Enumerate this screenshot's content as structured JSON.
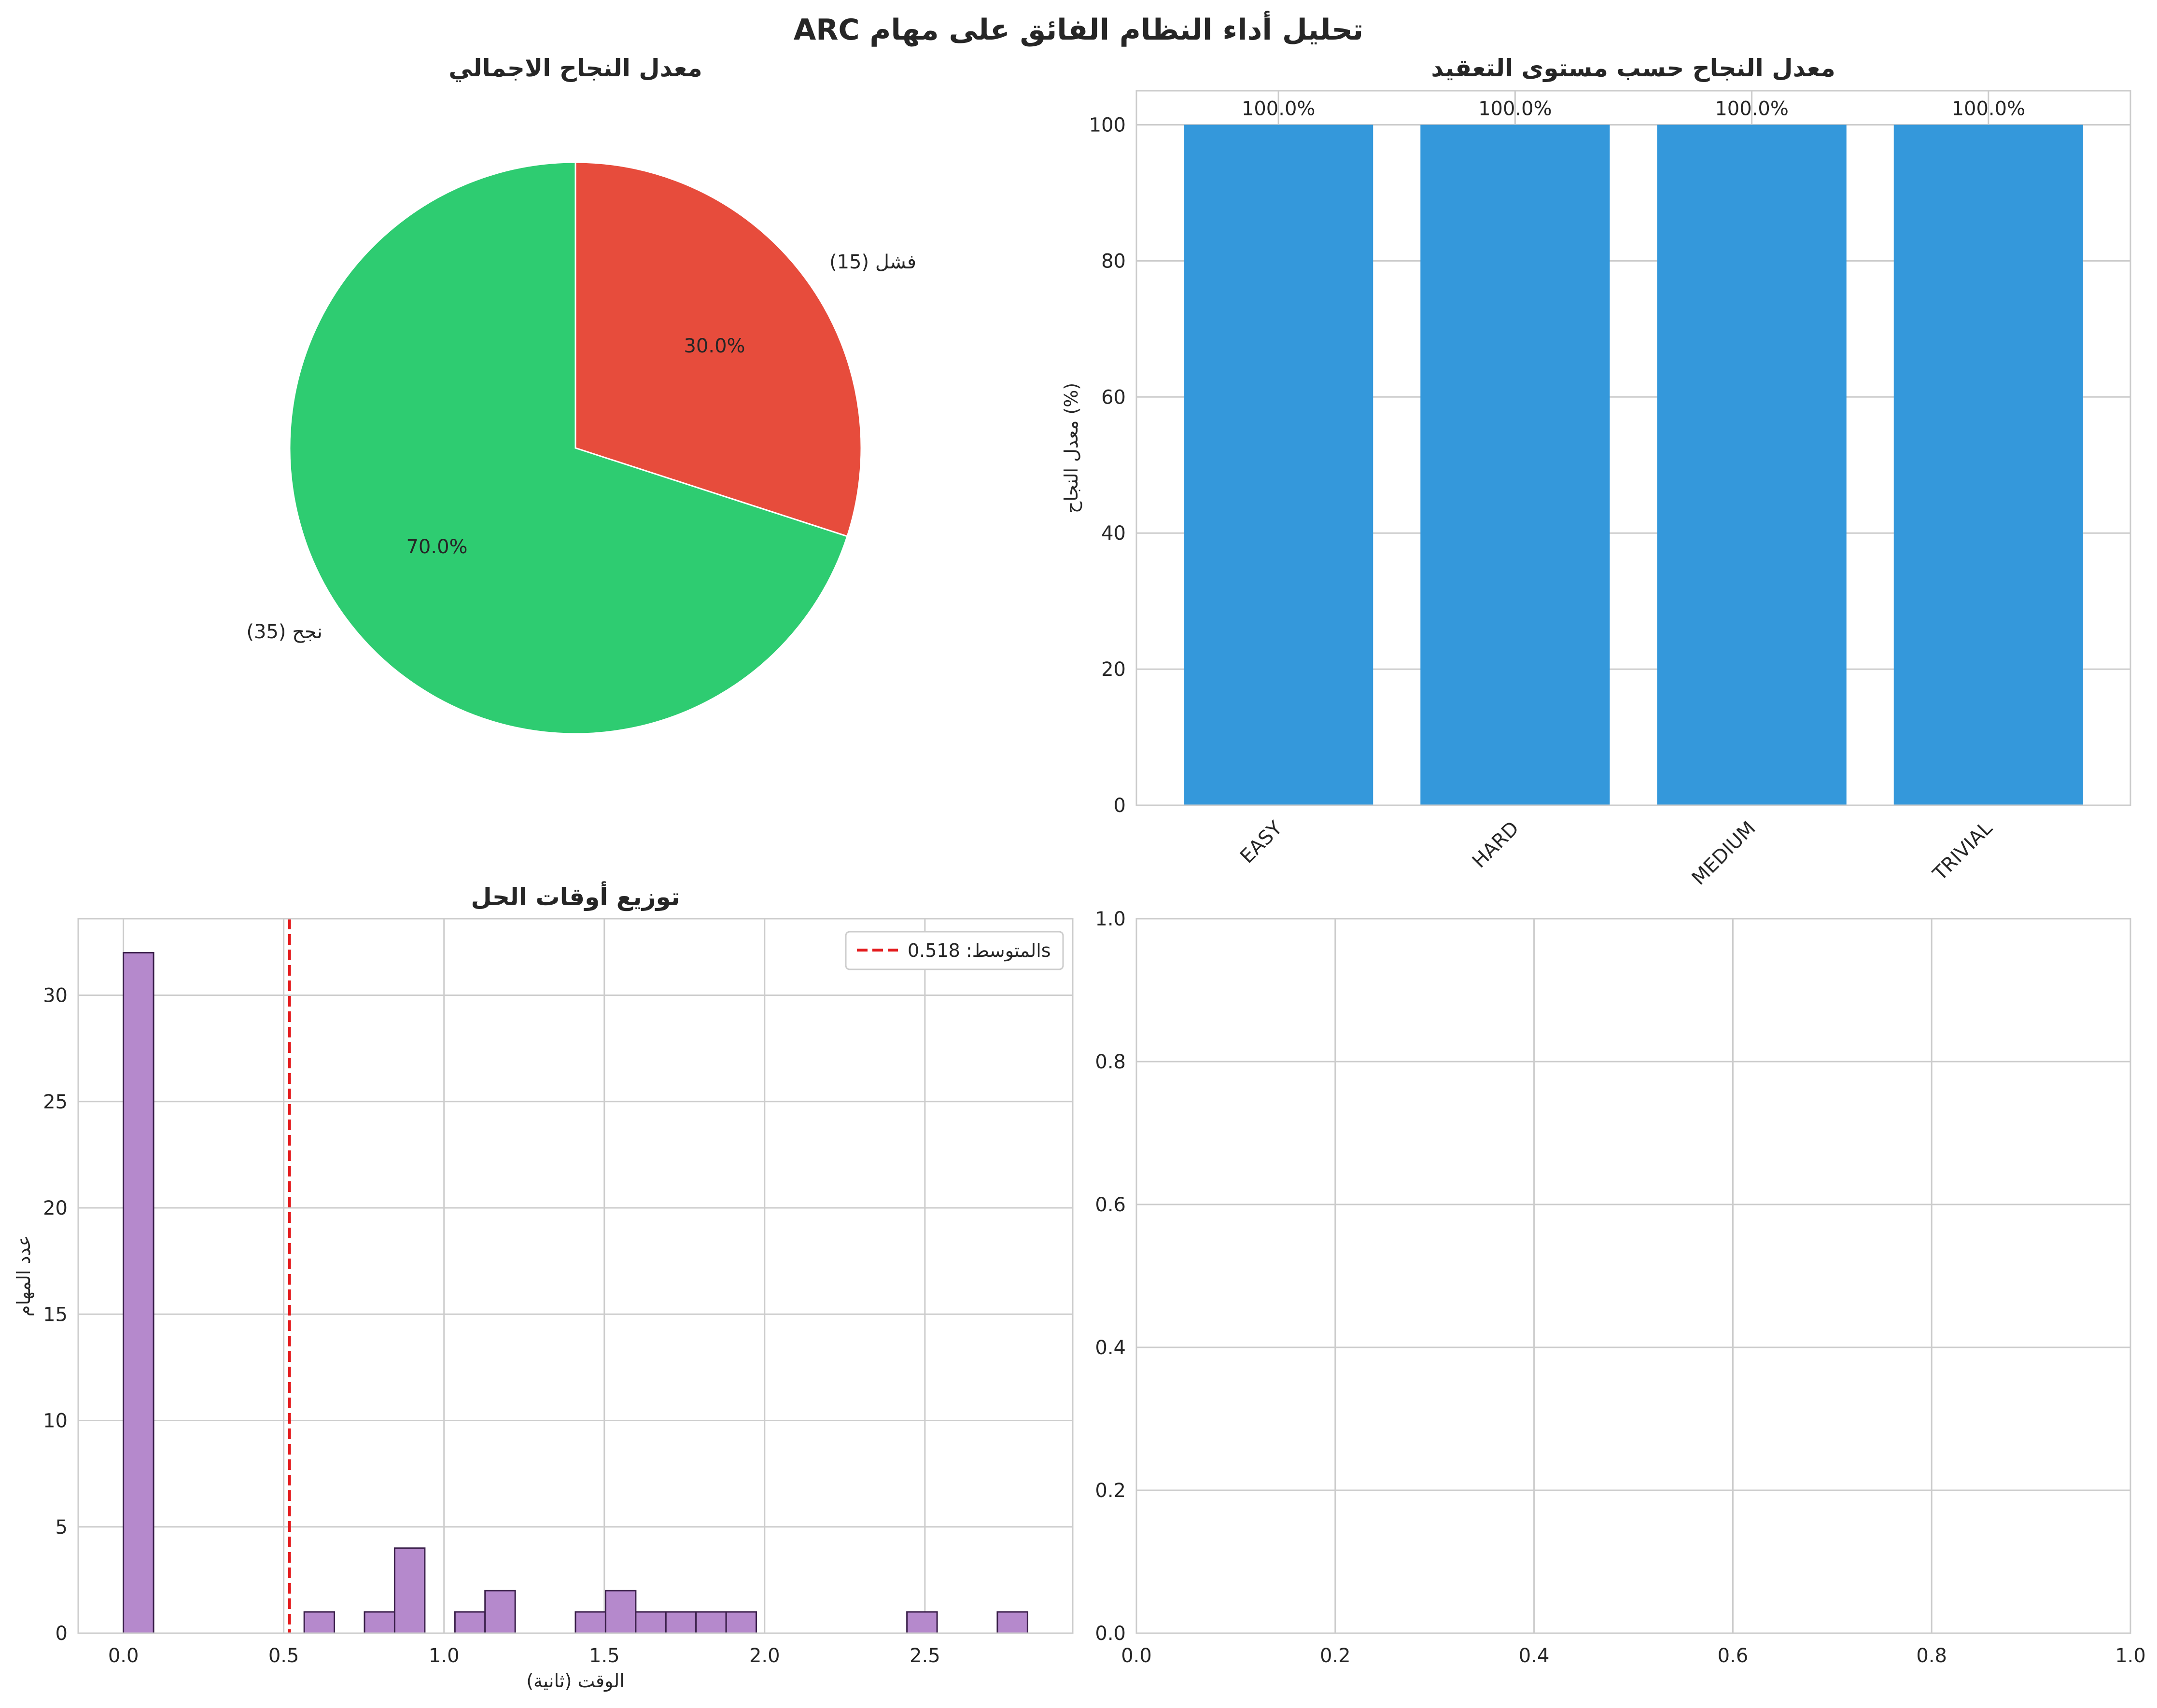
{
  "figure_title": "تحليل أداء النظام الفائق على مهام ARC",
  "colors": {
    "success": "#2ecc71",
    "failure": "#e74c3c",
    "bar": "#3498db",
    "hist": "#b589cc",
    "mean_line": "#e31a1c",
    "grid": "#cccccc"
  },
  "chart_data": [
    {
      "type": "pie",
      "title": "معدل النجاح الاجمالي",
      "slices": [
        {
          "label": "نجح (35)",
          "value": 35,
          "percent_label": "70.0%",
          "color": "#2ecc71"
        },
        {
          "label": "فشل (15)",
          "value": 15,
          "percent_label": "30.0%",
          "color": "#e74c3c"
        }
      ],
      "start_angle_deg": 90,
      "direction": "counterclockwise_from_failure"
    },
    {
      "type": "bar",
      "title": "معدل النجاح حسب مستوى التعقيد",
      "categories": [
        "EASY",
        "HARD",
        "MEDIUM",
        "TRIVIAL"
      ],
      "values": [
        100,
        100,
        100,
        100
      ],
      "value_labels": [
        "100.0%",
        "100.0%",
        "100.0%",
        "100.0%"
      ],
      "ylabel": "معدل النجاح (%)",
      "xlabel": "",
      "ylim": [
        0,
        105
      ],
      "yticks": [
        0,
        20,
        40,
        60,
        80,
        100
      ],
      "grid": true
    },
    {
      "type": "bar",
      "subtype": "histogram",
      "title": "توزيع أوقات الحل",
      "xlabel": "الوقت (ثانية)",
      "ylabel": "عدد المهام",
      "bin_width": 0.094,
      "bins": [
        {
          "x": 0.0,
          "count": 32
        },
        {
          "x": 0.564,
          "count": 1
        },
        {
          "x": 0.752,
          "count": 1
        },
        {
          "x": 0.846,
          "count": 4
        },
        {
          "x": 1.034,
          "count": 1
        },
        {
          "x": 1.128,
          "count": 2
        },
        {
          "x": 1.41,
          "count": 1
        },
        {
          "x": 1.504,
          "count": 2
        },
        {
          "x": 1.598,
          "count": 1
        },
        {
          "x": 1.692,
          "count": 1
        },
        {
          "x": 1.786,
          "count": 1
        },
        {
          "x": 1.88,
          "count": 1
        },
        {
          "x": 2.444,
          "count": 1
        },
        {
          "x": 2.726,
          "count": 1
        }
      ],
      "mean": 0.518,
      "legend_label": "المتوسط: 0.518s",
      "legend_position": "top-right",
      "xlim": [
        -0.141,
        2.961
      ],
      "ylim": [
        0,
        33.6
      ],
      "xticks": [
        "0.0",
        "0.5",
        "1.0",
        "1.5",
        "2.0",
        "2.5"
      ],
      "yticks": [
        "0",
        "5",
        "10",
        "15",
        "20",
        "25",
        "30"
      ],
      "grid": true
    },
    {
      "type": "scatter",
      "title": "",
      "series": [],
      "xlim": [
        0,
        1
      ],
      "ylim": [
        0,
        1
      ],
      "xticks": [
        "0.0",
        "0.2",
        "0.4",
        "0.6",
        "0.8",
        "1.0"
      ],
      "yticks": [
        "0.0",
        "0.2",
        "0.4",
        "0.6",
        "0.8",
        "1.0"
      ],
      "grid": true
    }
  ]
}
